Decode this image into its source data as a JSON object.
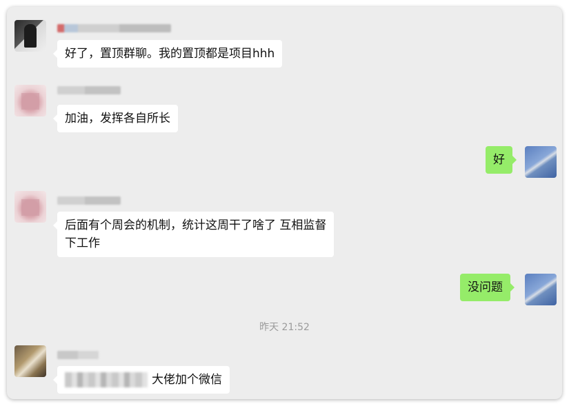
{
  "messages": [
    {
      "side": "left",
      "text": "好了，置顶群聊。我的置顶都是项目hhh",
      "avatar_icon": "dark-haired-person-avatar"
    },
    {
      "side": "left",
      "text": "加油，发挥各自所长",
      "avatar_icon": "pink-pixelated-avatar"
    },
    {
      "side": "right",
      "text": "好",
      "avatar_icon": "sky-photo-avatar"
    },
    {
      "side": "left",
      "text_line1": "后面有个周会的机制，统计这周干了啥了 互相监督",
      "text_line2": "下工作",
      "avatar_icon": "pink-pixelated-avatar"
    },
    {
      "side": "right",
      "text": "没问题",
      "avatar_icon": "sky-photo-avatar"
    },
    {
      "side": "left",
      "text": "大佬加个微信",
      "avatar_icon": "brown-pixelated-avatar"
    }
  ],
  "timestamp": "昨天 21:52",
  "colors": {
    "background": "#ededed",
    "left_bubble": "#ffffff",
    "right_bubble": "#95ec69",
    "timestamp": "#9a9a9a"
  }
}
